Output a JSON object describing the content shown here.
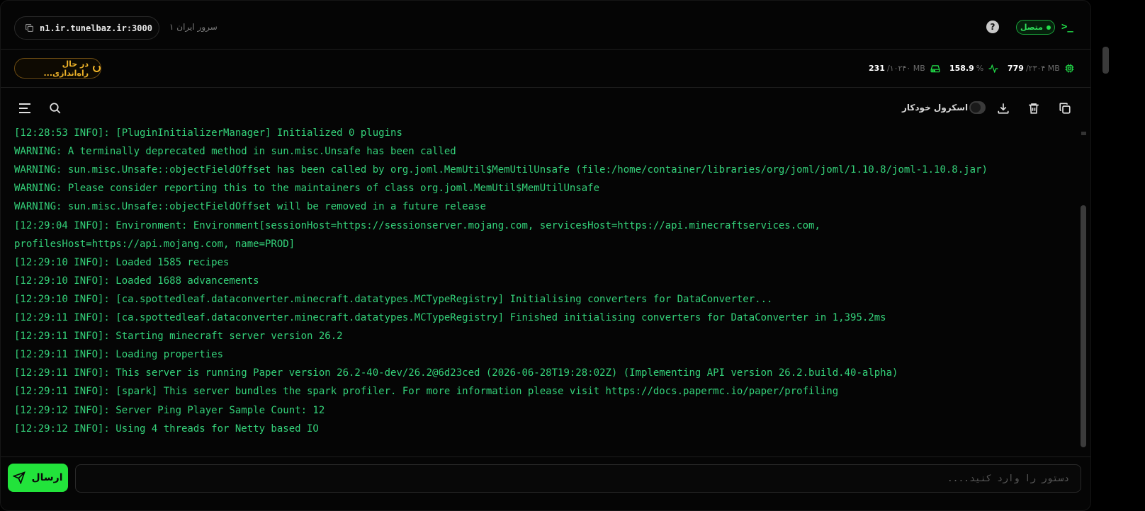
{
  "header": {
    "address": "n1.ir.tunelbaz.ir:3000",
    "server_name": "سرور ایران ۱",
    "help_symbol": "?",
    "status_label": "متصل",
    "logo_symbol": ">_"
  },
  "stats": {
    "boot_status": "در حال راه‌اندازی...",
    "memory": {
      "value": "779",
      "limit": "/۲۳۰۴ MB"
    },
    "cpu": {
      "value": "158.9",
      "unit": "%"
    },
    "disk": {
      "value": "231",
      "limit": "/۱۰۲۴۰ MB"
    }
  },
  "toolbar": {
    "autoscroll_label": "اسکرول خودکار",
    "autoscroll_on": false
  },
  "console": {
    "lines": [
      "[12:28:53 INFO]: [PluginInitializerManager] Initialized 0 plugins",
      "WARNING: A terminally deprecated method in sun.misc.Unsafe has been called",
      "WARNING: sun.misc.Unsafe::objectFieldOffset has been called by org.joml.MemUtil$MemUtilUnsafe (file:/home/container/libraries/org/joml/joml/1.10.8/joml-1.10.8.jar)",
      "WARNING: Please consider reporting this to the maintainers of class org.joml.MemUtil$MemUtilUnsafe",
      "WARNING: sun.misc.Unsafe::objectFieldOffset will be removed in a future release",
      "[12:29:04 INFO]: Environment: Environment[sessionHost=https://sessionserver.mojang.com, servicesHost=https://api.minecraftservices.com,",
      "profilesHost=https://api.mojang.com, name=PROD]",
      "[12:29:10 INFO]: Loaded 1585 recipes",
      "[12:29:10 INFO]: Loaded 1688 advancements",
      "[12:29:10 INFO]: [ca.spottedleaf.dataconverter.minecraft.datatypes.MCTypeRegistry] Initialising converters for DataConverter...",
      "[12:29:11 INFO]: [ca.spottedleaf.dataconverter.minecraft.datatypes.MCTypeRegistry] Finished initialising converters for DataConverter in 1,395.2ms",
      "[12:29:11 INFO]: Starting minecraft server version 26.2",
      "[12:29:11 INFO]: Loading properties",
      "[12:29:11 INFO]: This server is running Paper version 26.2-40-dev/26.2@6d23ced (2026-06-28T19:28:02Z) (Implementing API version 26.2.build.40-alpha)",
      "[12:29:11 INFO]: [spark] This server bundles the spark profiler. For more information please visit https://docs.papermc.io/paper/profiling",
      "[12:29:12 INFO]: Server Ping Player Sample Count: 12",
      "[12:29:12 INFO]: Using 4 threads for Netty based IO"
    ]
  },
  "command": {
    "placeholder": "دستور را وارد کنید....",
    "value": "",
    "send_label": "ارسال"
  },
  "colors": {
    "accent": "#22e33b",
    "log_text": "#34d27a",
    "warning": "#f0b429",
    "background": "#050505"
  }
}
